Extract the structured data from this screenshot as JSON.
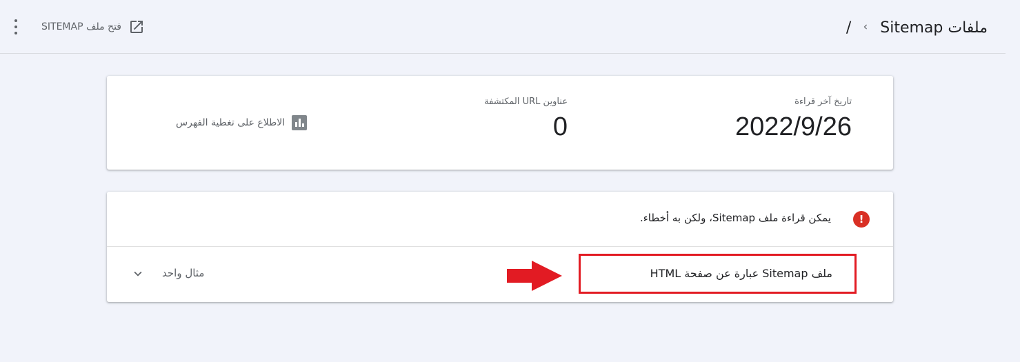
{
  "header": {
    "breadcrumb_parent": "ملفات Sitemap",
    "breadcrumb_separator_icon": "chevron-left-icon",
    "breadcrumb_current": "/",
    "open_sitemap_label": "فتح ملف SITEMAP",
    "open_icon": "open-in-new-icon",
    "more_icon": "more-vert-icon"
  },
  "summary": {
    "last_read_label": "تاريخ آخر قراءة",
    "last_read_value": "2022/9/26",
    "discovered_urls_label": "عناوين URL المكتشفة",
    "discovered_urls_value": "0",
    "coverage_link": "الاطلاع على تغطية الفهرس",
    "coverage_icon": "bar-chart-icon"
  },
  "issues": {
    "error_icon": "error-icon",
    "error_color": "#d93025",
    "error_message": "يمكن قراءة ملف Sitemap، ولكن به أخطاء.",
    "example_title": "ملف Sitemap عبارة عن صفحة HTML",
    "example_count": "مثال واحد",
    "expand_icon": "chevron-down-icon",
    "highlight_color": "#e21b23"
  }
}
